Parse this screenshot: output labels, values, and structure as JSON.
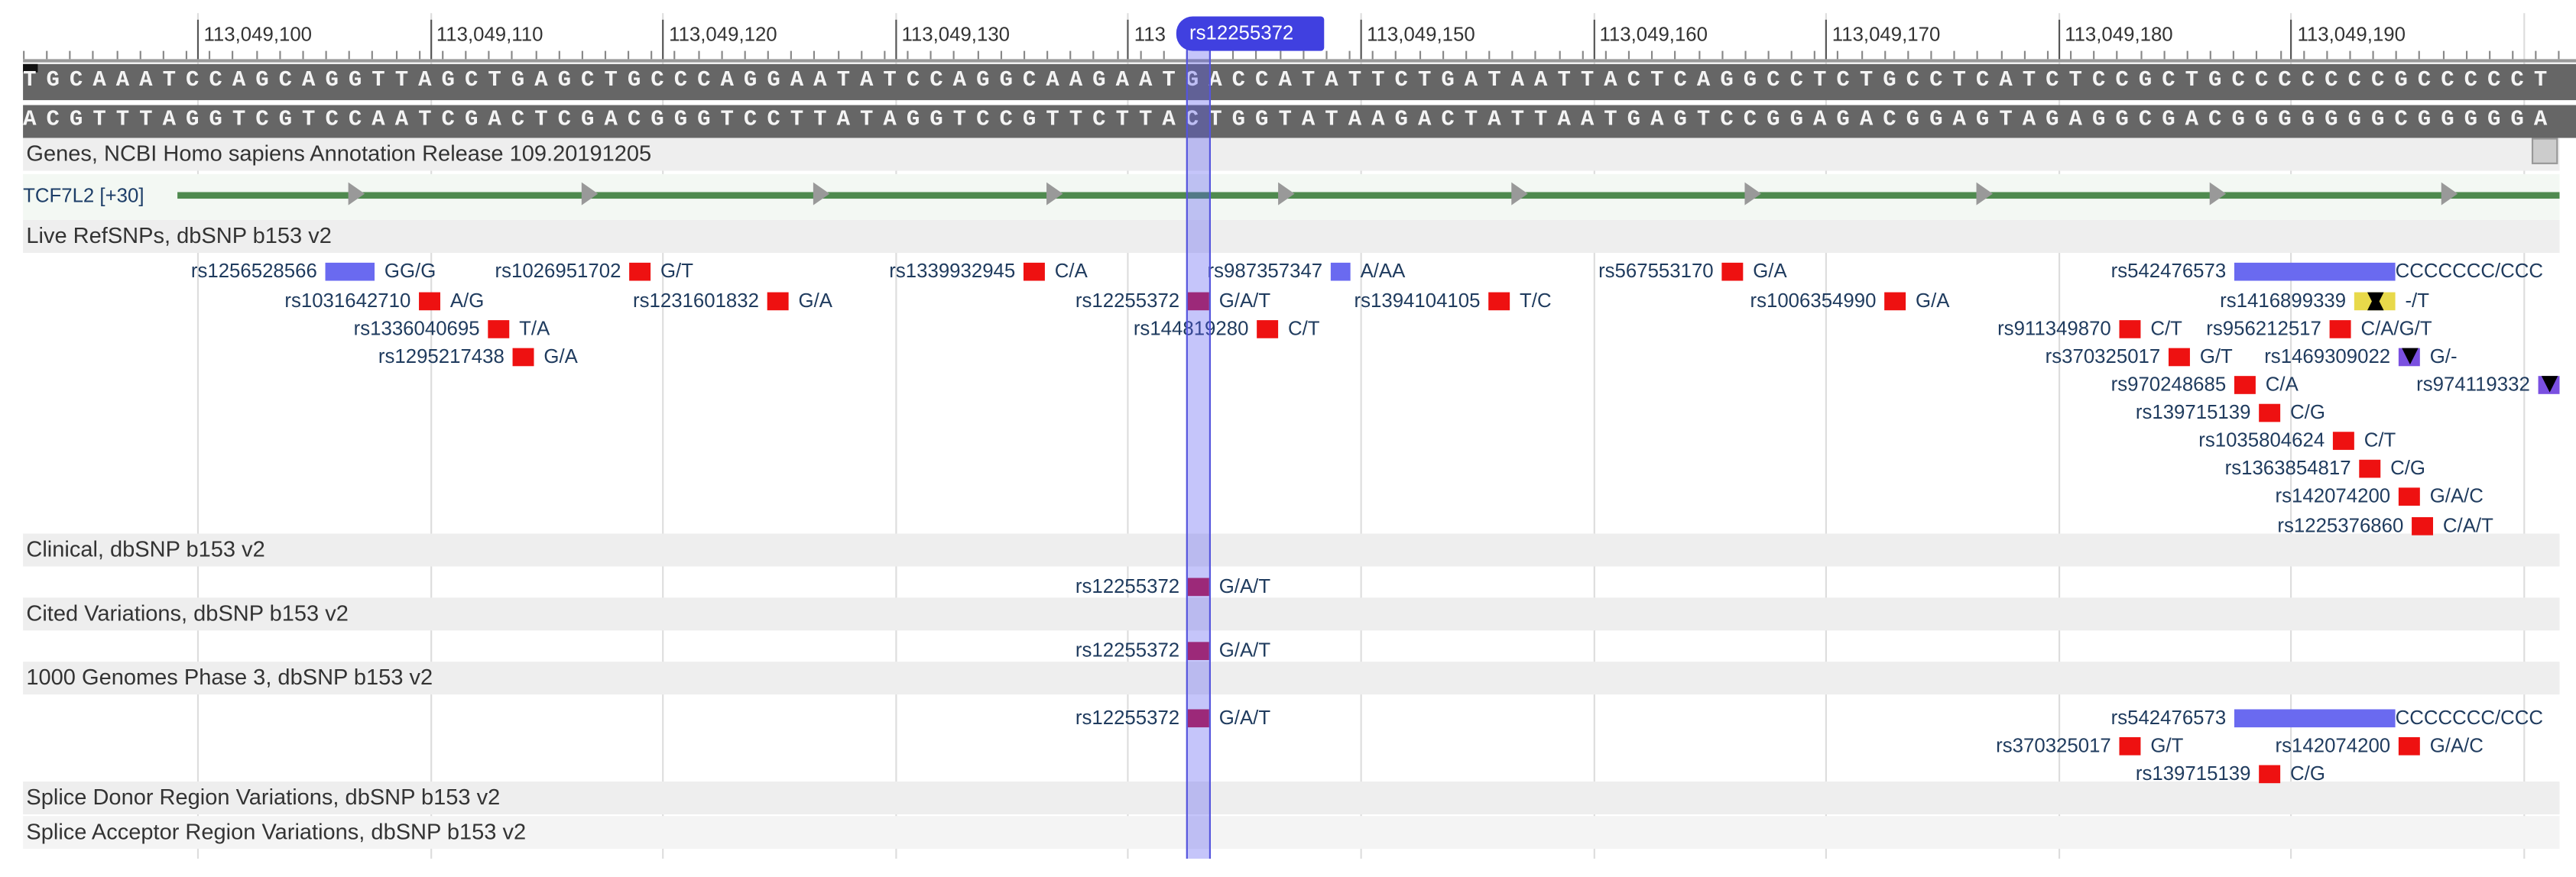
{
  "ruler": {
    "ticks": [
      "113,049,100",
      "113,049,110",
      "113,049,120",
      "113,049,130",
      "113",
      "113,049,150",
      "113,049,160",
      "113,049,170",
      "113,049,180",
      "113,049,190"
    ],
    "selected_marker": "rs12255372"
  },
  "sequence": {
    "forward": "TGCAAATCCAGCAGGTTAGCTGAGCTGCCCAGGAATATCCAGGCAAGAATGACCATATTCTGATAATTACTCAGGCCTCTGCCTCATCTCCGCTGCCCCCCCGCCCCCT",
    "reverse": "ACGTTTAGGTCGTCCAATCGACTCGACGGGTCCTTATAGGTCCGTTCTTACTGGTATAAGACTATTAATGAGTCCGGAGACGGAGTAGAGGCGACGGGGGGGCGGGGGA"
  },
  "tracks": {
    "genes": {
      "title": "Genes, NCBI Homo sapiens Annotation Release 109.20191205",
      "gene_label": "TCF7L2 [+30]"
    },
    "live": {
      "title": "Live RefSNPs, dbSNP b153 v2",
      "snps": [
        {
          "id": "rs1256528566",
          "allele": "GG/G",
          "marker": "insertion"
        },
        {
          "id": "rs1026951702",
          "allele": "G/T",
          "marker": "snv"
        },
        {
          "id": "rs1339932945",
          "allele": "C/A",
          "marker": "snv"
        },
        {
          "id": "rs987357347",
          "allele": "A/AA",
          "marker": "insertion"
        },
        {
          "id": "rs567553170",
          "allele": "G/A",
          "marker": "snv"
        },
        {
          "id": "rs542476573",
          "allele": "CCCCCCC/CCC",
          "marker": "insertion"
        },
        {
          "id": "rs1031642710",
          "allele": "A/G",
          "marker": "snv"
        },
        {
          "id": "rs1231601832",
          "allele": "G/A",
          "marker": "snv"
        },
        {
          "id": "rs12255372",
          "allele": "G/A/T",
          "marker": "snv"
        },
        {
          "id": "rs1394104105",
          "allele": "T/C",
          "marker": "snv"
        },
        {
          "id": "rs1006354990",
          "allele": "G/A",
          "marker": "snv"
        },
        {
          "id": "rs1416899339",
          "allele": "-/T",
          "marker": "ins-point"
        },
        {
          "id": "rs1336040695",
          "allele": "T/A",
          "marker": "snv"
        },
        {
          "id": "rs144819280",
          "allele": "C/T",
          "marker": "snv"
        },
        {
          "id": "rs911349870",
          "allele": "C/T",
          "marker": "snv"
        },
        {
          "id": "rs956212517",
          "allele": "C/A/G/T",
          "marker": "snv"
        },
        {
          "id": "rs1295217438",
          "allele": "G/A",
          "marker": "snv"
        },
        {
          "id": "rs370325017",
          "allele": "G/T",
          "marker": "snv"
        },
        {
          "id": "rs1469309022",
          "allele": "G/-",
          "marker": "deletion"
        },
        {
          "id": "rs970248685",
          "allele": "C/A",
          "marker": "snv"
        },
        {
          "id": "rs974119332",
          "allele": "",
          "marker": "deletion"
        },
        {
          "id": "rs139715139",
          "allele": "C/G",
          "marker": "snv"
        },
        {
          "id": "rs1035804624",
          "allele": "C/T",
          "marker": "snv"
        },
        {
          "id": "rs1363854817",
          "allele": "C/G",
          "marker": "snv"
        },
        {
          "id": "rs142074200",
          "allele": "G/A/C",
          "marker": "snv"
        },
        {
          "id": "rs1225376860",
          "allele": "C/A/T",
          "marker": "snv"
        }
      ]
    },
    "clinical": {
      "title": "Clinical, dbSNP b153 v2",
      "snps": [
        {
          "id": "rs12255372",
          "allele": "G/A/T",
          "marker": "snv"
        }
      ]
    },
    "cited": {
      "title": "Cited Variations, dbSNP b153 v2",
      "snps": [
        {
          "id": "rs12255372",
          "allele": "G/A/T",
          "marker": "snv"
        }
      ]
    },
    "genomes": {
      "title": "1000 Genomes Phase 3, dbSNP b153 v2",
      "snps": [
        {
          "id": "rs12255372",
          "allele": "G/A/T",
          "marker": "snv"
        },
        {
          "id": "rs542476573",
          "allele": "CCCCCCC/CCC",
          "marker": "insertion"
        },
        {
          "id": "rs370325017",
          "allele": "G/T",
          "marker": "snv"
        },
        {
          "id": "rs142074200",
          "allele": "G/A/C",
          "marker": "snv"
        },
        {
          "id": "rs139715139",
          "allele": "C/G",
          "marker": "snv"
        }
      ]
    },
    "splice_donor": {
      "title": "Splice Donor Region Variations, dbSNP b153 v2"
    },
    "splice_acceptor": {
      "title": "Splice Acceptor Region Variations, dbSNP b153 v2"
    }
  },
  "colors": {
    "snv": "#ee1111",
    "insertion": "#6a6af0",
    "ins-point": "#e8d94a",
    "deletion": "#7a50e0",
    "selected": "#4040e0",
    "gene": "#4f8a4f"
  }
}
